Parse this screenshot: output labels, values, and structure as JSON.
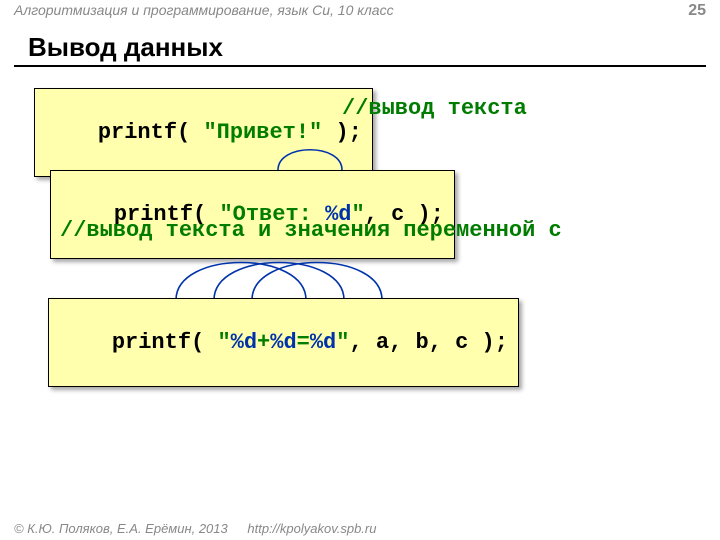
{
  "header": {
    "course": "Алгоритмизация и программирование, язык Си, 10 класс",
    "page": "25"
  },
  "title": "Вывод данных",
  "code1": {
    "printf": "printf( ",
    "str": "\"Привет!\"",
    "tail": " );"
  },
  "comment1": "//вывод текста",
  "code2": {
    "printf": "printf( ",
    "str_a": "\"Ответ: ",
    "fmt": "%d",
    "str_b": "\"",
    "comma": ", ",
    "var": "c",
    "tail": " );"
  },
  "comment2": "//вывод текста и значения переменной c",
  "code3": {
    "printf": "printf( ",
    "q1": "\"",
    "f1": "%d",
    "plus": "+",
    "f2": "%d",
    "eq": "=",
    "f3": "%d",
    "q2": "\"",
    "c1": ", ",
    "a": "a",
    "c2": ", ",
    "b": "b",
    "c3": ", ",
    "c": "c",
    "tail": " );"
  },
  "footer": {
    "copyright": "© К.Ю. Поляков, Е.А. Ерёмин, 2013",
    "url": "http://kpolyakov.spb.ru"
  }
}
